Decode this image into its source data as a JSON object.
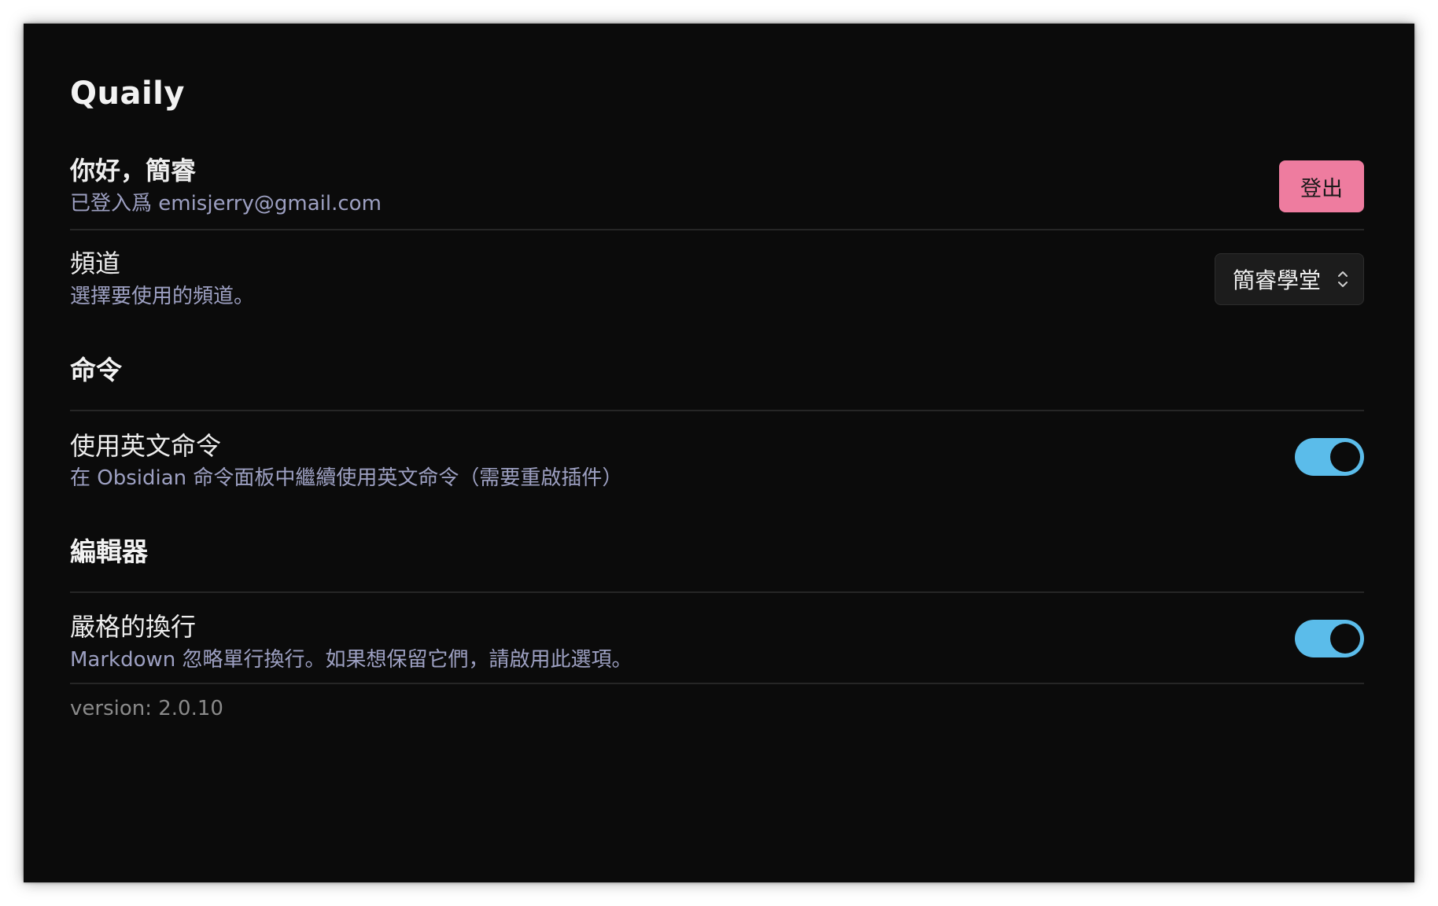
{
  "app": {
    "title": "Quaily"
  },
  "account": {
    "greeting": "你好，簡睿",
    "signed_in_as": "已登入爲 emisjerry@gmail.com",
    "logout_label": "登出"
  },
  "channel": {
    "name": "頻道",
    "description": "選擇要使用的頻道。",
    "selected_value": "簡睿學堂"
  },
  "commands": {
    "heading": "命令",
    "english_commands": {
      "name": "使用英文命令",
      "description": "在 Obsidian 命令面板中繼續使用英文命令（需要重啟插件）",
      "enabled": true
    }
  },
  "editor": {
    "heading": "編輯器",
    "strict_line_breaks": {
      "name": "嚴格的換行",
      "description": "Markdown 忽略單行換行。如果想保留它們，請啟用此選項。",
      "enabled": true
    }
  },
  "footer": {
    "version": "version: 2.0.10"
  },
  "colors": {
    "accent_toggle": "#5bbcea",
    "logout_button": "#ee7c9f",
    "background": "#0b0b0b",
    "description_text": "#9da0c2"
  },
  "icons": {
    "select_chevron": "chevron-up-down-icon"
  }
}
